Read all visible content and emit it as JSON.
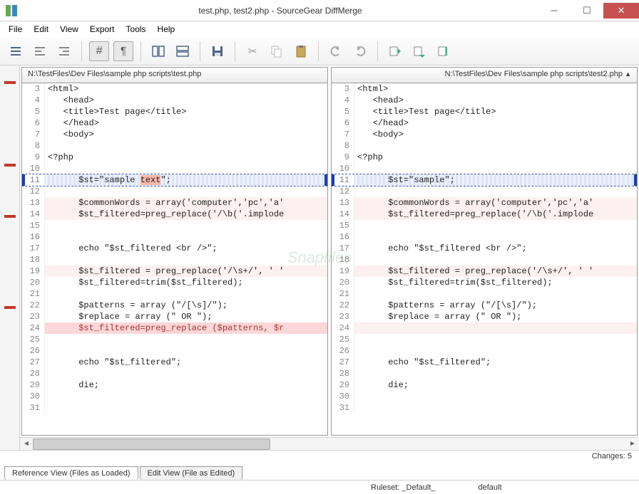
{
  "window": {
    "title": "test.php, test2.php - SourceGear DiffMerge"
  },
  "menu": {
    "file": "File",
    "edit": "Edit",
    "view": "View",
    "export": "Export",
    "tools": "Tools",
    "help": "Help"
  },
  "toolbar_icons": {
    "b1": "align-full-icon",
    "b2": "align-left-icon",
    "b3": "align-right-icon",
    "b4": "hash-icon",
    "b5": "pilcrow-icon",
    "b6": "split-vertical-icon",
    "b7": "split-horizontal-icon",
    "b8": "save-icon",
    "b9": "cut-icon",
    "b10": "copy-icon",
    "b11": "paste-icon",
    "b12": "undo-icon",
    "b13": "redo-icon",
    "b14": "first-diff-icon",
    "b15": "next-diff-icon",
    "b16": "last-diff-icon"
  },
  "panes": {
    "left": {
      "file_path": "N:\\TestFiles\\Dev Files\\sample php scripts\\test.php"
    },
    "right": {
      "file_path": "N:\\TestFiles\\Dev Files\\sample php scripts\\test2.php"
    }
  },
  "lines": {
    "l3": {
      "n": "3",
      "t": "<html>"
    },
    "l4": {
      "n": "4",
      "t": "   <head>"
    },
    "l5": {
      "n": "5",
      "t": "   <title>Test page</title>"
    },
    "l6": {
      "n": "6",
      "t": "   </head>"
    },
    "l7": {
      "n": "7",
      "t": "   <body>"
    },
    "l8": {
      "n": "8",
      "t": ""
    },
    "l9": {
      "n": "9",
      "t": "<?php"
    },
    "l10": {
      "n": "10",
      "t": ""
    },
    "l11L_a": "      $st=\"sample ",
    "l11L_b": "text",
    "l11L_c": "\";",
    "l11R": {
      "n": "11",
      "t": "      $st=\"sample\";"
    },
    "l11n": "11",
    "l12": {
      "n": "12",
      "t": ""
    },
    "l13": {
      "n": "13",
      "t": "      $commonWords = array('computer','pc','a'"
    },
    "l14": {
      "n": "14",
      "t": "      $st_filtered=preg_replace('/\\b('.implode"
    },
    "l15": {
      "n": "15",
      "t": ""
    },
    "l16": {
      "n": "16",
      "t": ""
    },
    "l17": {
      "n": "17",
      "t": "      echo \"$st_filtered <br />\";"
    },
    "l18": {
      "n": "18",
      "t": ""
    },
    "l19": {
      "n": "19",
      "t": "      $st_filtered = preg_replace('/\\s+/', ' '"
    },
    "l20": {
      "n": "20",
      "t": "      $st_filtered=trim($st_filtered);"
    },
    "l21": {
      "n": "21",
      "t": ""
    },
    "l22": {
      "n": "22",
      "t": "      $patterns = array (\"/[\\s]/\");"
    },
    "l23": {
      "n": "23",
      "t": "      $replace = array (\" OR \");"
    },
    "l24L": {
      "n": "24",
      "t": "      $st_filtered=preg_replace ($patterns, $r"
    },
    "l24R": {
      "n": "24",
      "t": ""
    },
    "l25": {
      "n": "25",
      "t": ""
    },
    "l26": {
      "n": "26",
      "t": ""
    },
    "l27": {
      "n": "27",
      "t": "      echo \"$st_filtered\";"
    },
    "l28": {
      "n": "28",
      "t": ""
    },
    "l29": {
      "n": "29",
      "t": "      die;"
    },
    "l30": {
      "n": "30",
      "t": ""
    },
    "l31": {
      "n": "31",
      "t": ""
    }
  },
  "status": {
    "changes": "Changes: 5",
    "ruleset_label": "Ruleset:",
    "ruleset_value": "_Default_",
    "mode": "default"
  },
  "tabs": {
    "reference": "Reference View (Files as Loaded)",
    "edit": "Edit View (File as Edited)"
  },
  "watermark": "Snapfiles"
}
